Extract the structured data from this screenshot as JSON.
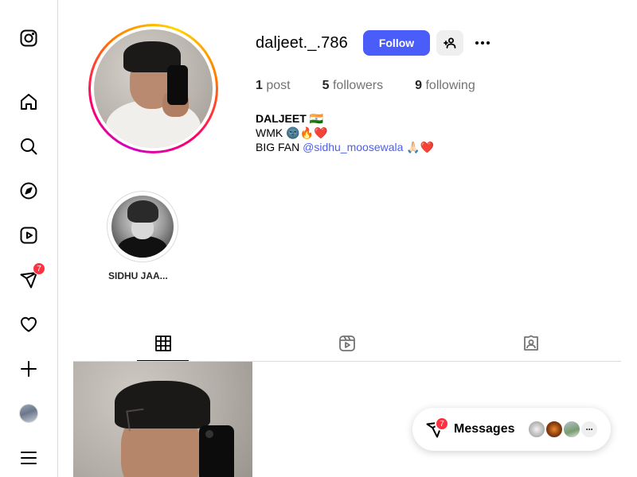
{
  "sidebar": {
    "items": [
      {
        "name": "instagram-logo-icon"
      },
      {
        "name": "home-icon"
      },
      {
        "name": "search-icon"
      },
      {
        "name": "explore-icon"
      },
      {
        "name": "reels-icon"
      },
      {
        "name": "messages-icon",
        "badge": "7"
      },
      {
        "name": "notifications-icon"
      },
      {
        "name": "create-icon"
      },
      {
        "name": "profile-avatar"
      },
      {
        "name": "menu-icon"
      }
    ]
  },
  "profile": {
    "username": "daljeet._.786",
    "follow_label": "Follow",
    "stats": {
      "posts_count": "1",
      "posts_label": "post",
      "followers_count": "5",
      "followers_label": "followers",
      "following_count": "9",
      "following_label": "following"
    },
    "bio": {
      "name": "DALJEET 🇮🇳",
      "line1": "WMK 🌚🔥❤️",
      "line2_prefix": "BIG FAN ",
      "mention": "@sidhu_moosewala",
      "line2_suffix": " 🙏🏻❤️"
    }
  },
  "highlights": [
    {
      "label": "SIDHU JAA..."
    }
  ],
  "tabs": [
    {
      "name": "posts-tab",
      "icon": "grid-icon",
      "active": true
    },
    {
      "name": "reels-tab",
      "icon": "reels-icon",
      "active": false
    },
    {
      "name": "tagged-tab",
      "icon": "tagged-icon",
      "active": false
    }
  ],
  "messages": {
    "label": "Messages",
    "badge": "7",
    "more": "···"
  },
  "colors": {
    "accent": "#4a5df9",
    "badge": "#ff3040",
    "border": "#dbdbdb"
  }
}
